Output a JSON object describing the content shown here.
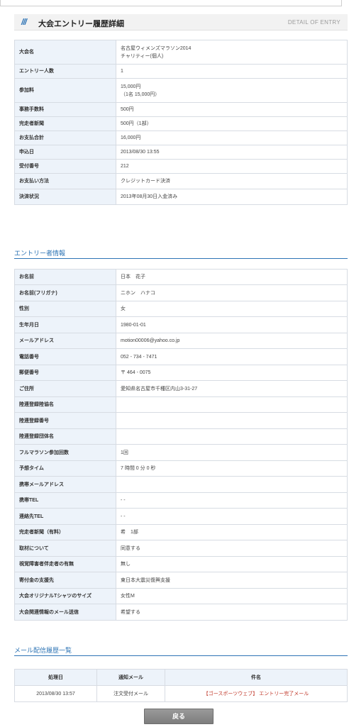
{
  "banner": {
    "title": "大会エントリー履歴詳細",
    "subtitle": "DETAIL OF ENTRY"
  },
  "entry_detail": [
    {
      "label": "大会名",
      "value": "名古屋ウィメンズマラソン2014",
      "value2": "チャリティー(個人)"
    },
    {
      "label": "エントリー人数",
      "value": "1"
    },
    {
      "label": "参加料",
      "value": "15,000円",
      "value2": "（1名 15,000円）"
    },
    {
      "label": "事務手数料",
      "value": "500円"
    },
    {
      "label": "完走者新聞",
      "value": "500円（1部）"
    },
    {
      "label": "お支払合計",
      "value": "16,000円"
    },
    {
      "label": "申込日",
      "value": "2013/08/30 13:55"
    },
    {
      "label": "受付番号",
      "value": "212"
    },
    {
      "label": "お支払い方法",
      "value": "クレジットカード決済"
    },
    {
      "label": "決済状況",
      "value": "2013年08月30日入金済み"
    }
  ],
  "entrant_heading": "エントリー者情報",
  "entrant": [
    {
      "label": "お名前",
      "value": "日本　花子"
    },
    {
      "label": "お名前(フリガナ)",
      "value": "ニホン　ハナコ"
    },
    {
      "label": "性別",
      "value": "女"
    },
    {
      "label": "生年月日",
      "value": "1980-01-01"
    },
    {
      "label": "メールアドレス",
      "value": "motion00006@yahoo.co.jp"
    },
    {
      "label": "電話番号",
      "value": "052 - 734 - 7471"
    },
    {
      "label": "郵便番号",
      "value": "〒 464 - 0075"
    },
    {
      "label": "ご住所",
      "value": "愛知県名古屋市千種区内山3-31-27"
    },
    {
      "label": "陸連登録陸協名",
      "value": ""
    },
    {
      "label": "陸連登録番号",
      "value": ""
    },
    {
      "label": "陸連登録団体名",
      "value": ""
    },
    {
      "label": "フルマラソン参加回数",
      "value": "1回"
    },
    {
      "label": "予想タイム",
      "value": "7 時間 0 分 0 秒"
    },
    {
      "label": "携帯メールアドレス",
      "value": ""
    },
    {
      "label": "携帯TEL",
      "value": "- -"
    },
    {
      "label": "連絡先TEL",
      "value": "- -"
    },
    {
      "label": "完走者新聞（有料）",
      "value": "希　1部"
    },
    {
      "label": "取材について",
      "value": "同意する"
    },
    {
      "label": "視覚障害者伴走者の有無",
      "value": "無し"
    },
    {
      "label": "寄付金の支援先",
      "value": "東日本大震災復興支援"
    },
    {
      "label": "大会オリジナルTシャツのサイズ",
      "value": "女性M"
    },
    {
      "label": "大会関連情報のメール送信",
      "value": "希望する"
    }
  ],
  "history_heading": "メール配信履歴一覧",
  "history": {
    "columns": [
      "処理日",
      "通知メール",
      "件名"
    ],
    "rows": [
      {
        "date": "2013/08/30 13:57",
        "type": "注文受付メール",
        "subject": "【ゴースポーツウェブ】 エントリー完了メール"
      }
    ]
  },
  "back_label": "戻る",
  "colors": {
    "accent": "#2e74b5",
    "header_cell": "#edf3fa",
    "link": "#c0392b"
  }
}
